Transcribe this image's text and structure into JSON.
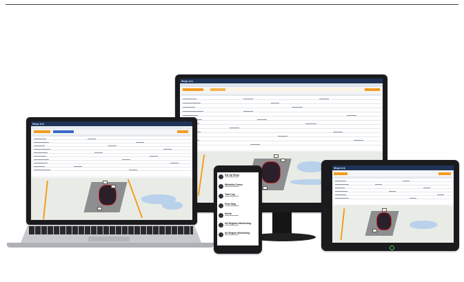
{
  "page": {
    "background": "#ffffff",
    "accent": "#f39c1e",
    "nav_color": "#1e3356"
  },
  "brand": {
    "name": "MapLink"
  },
  "devices": {
    "monitor": {
      "label": "desktop-monitor"
    },
    "laptop": {
      "label": "laptop"
    },
    "phone": {
      "label": "smartphone"
    },
    "tablet": {
      "label": "tablet"
    }
  },
  "phone_app": {
    "items": [
      {
        "title": "Set Up Shop",
        "icon": "wrench-icon"
      },
      {
        "title": "Whitelist Zones",
        "icon": "shield-icon"
      },
      {
        "title": "Tool Log",
        "icon": "tool-icon"
      },
      {
        "title": "Post Stop",
        "icon": "stop-icon"
      },
      {
        "title": "Alerts",
        "icon": "alert-icon"
      },
      {
        "title": "All Regions Monitoring",
        "icon": "gear-icon"
      },
      {
        "title": "All Region Monitoring",
        "icon": "gear-icon"
      }
    ]
  }
}
